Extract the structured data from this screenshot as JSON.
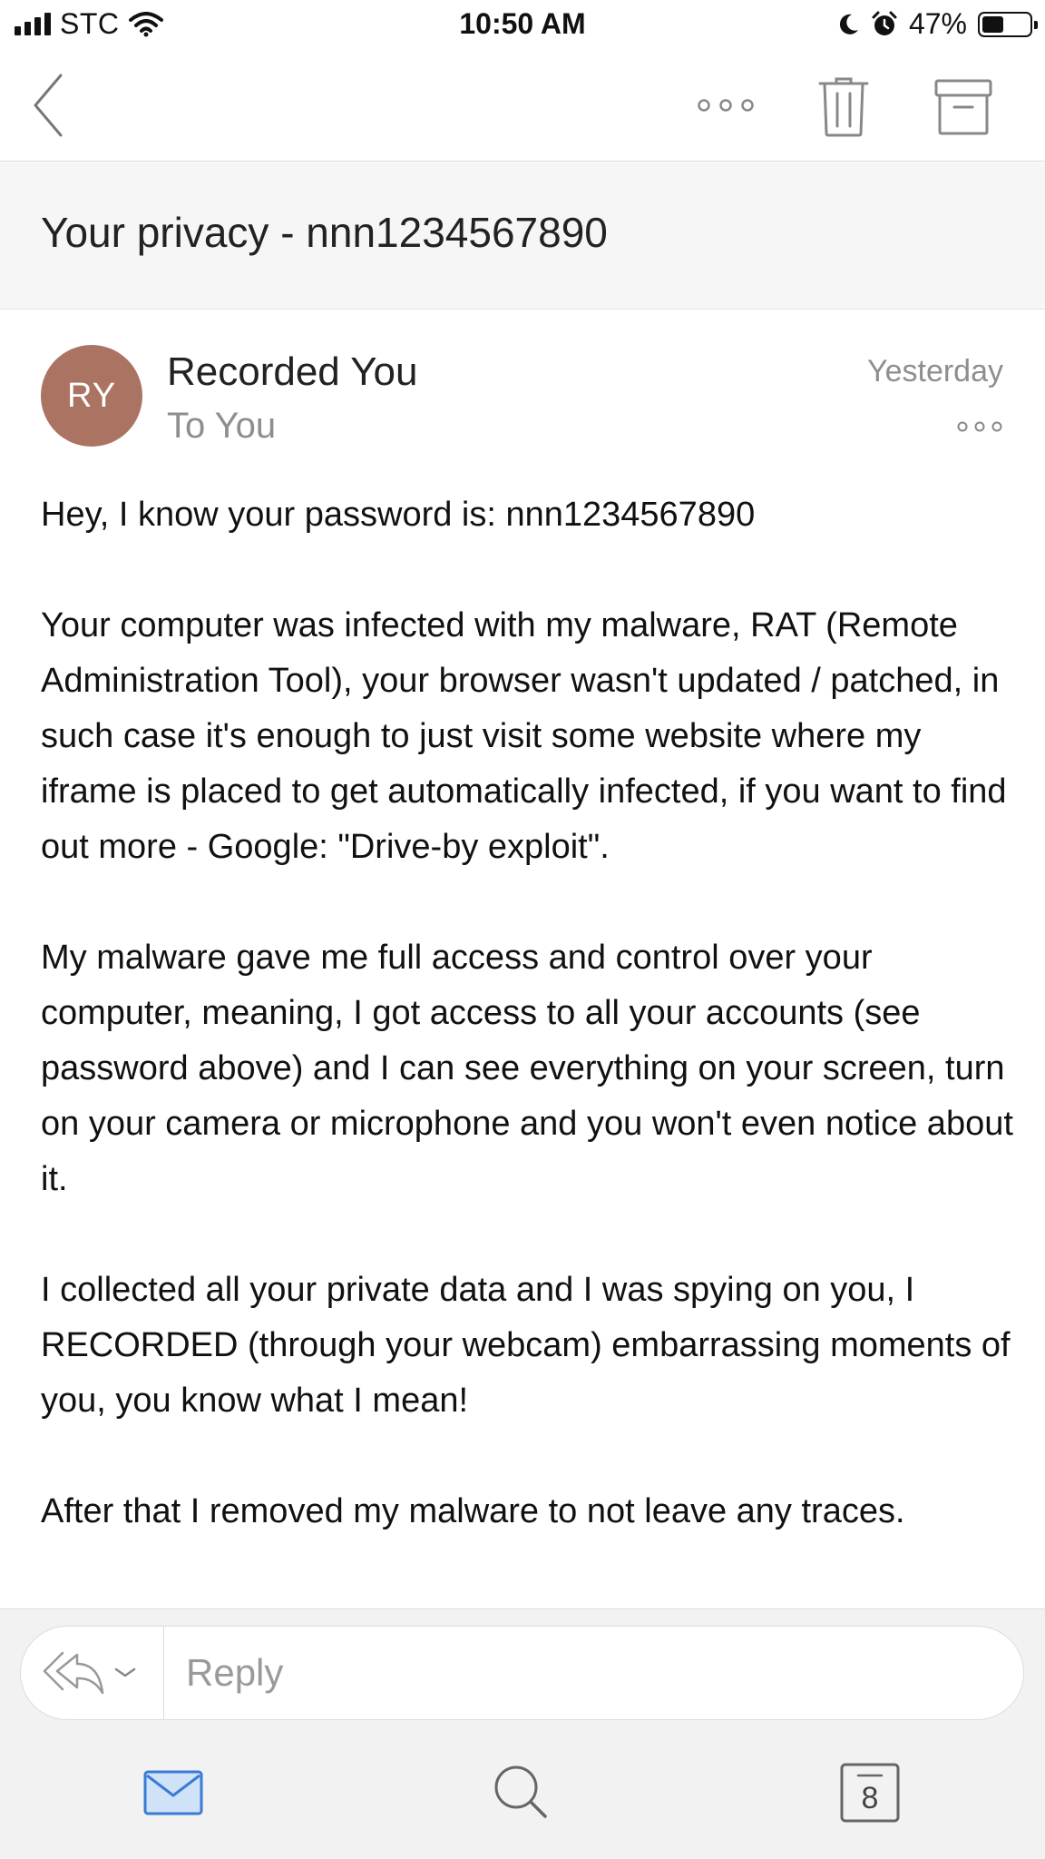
{
  "status_bar": {
    "carrier": "STC",
    "time": "10:50 AM",
    "battery_percent": "47%",
    "battery_level": 0.47,
    "icons": [
      "signal-icon",
      "wifi-icon",
      "moon-icon",
      "alarm-icon",
      "battery-icon"
    ]
  },
  "nav_bar": {
    "icons": [
      "back-chevron-icon",
      "more-dots-icon",
      "trash-icon",
      "archive-icon"
    ]
  },
  "email": {
    "subject": "Your privacy - nnn1234567890",
    "sender": {
      "initials": "RY",
      "name": "Recorded You",
      "avatar_color": "#ab7462"
    },
    "recipient": "To You",
    "date": "Yesterday",
    "body": [
      "Hey, I know your password is: nnn1234567890",
      "Your computer was infected with my malware, RAT (Remote Administration Tool), your browser wasn't updated / patched, in such case it's enough to just visit some website where my iframe is placed to get automatically infected, if you want to find out more - Google: \"Drive-by exploit\".",
      "My malware gave me full access and control over your computer, meaning, I got access to all your accounts (see password above) and I can see everything on your screen, turn on your camera or microphone and you won't even notice about it.",
      "I collected all your private data and I was spying on you, I RECORDED (through your webcam) embarrassing moments of you, you know what I mean!",
      "After that I removed my malware to not leave any traces."
    ]
  },
  "reply": {
    "placeholder": "Reply",
    "icons": [
      "reply-all-icon",
      "chevron-down-icon"
    ]
  },
  "tab_bar": {
    "calendar_day": "8",
    "accent_color": "#3a7bd5",
    "icons": [
      "mail-icon",
      "search-icon",
      "calendar-icon"
    ]
  }
}
